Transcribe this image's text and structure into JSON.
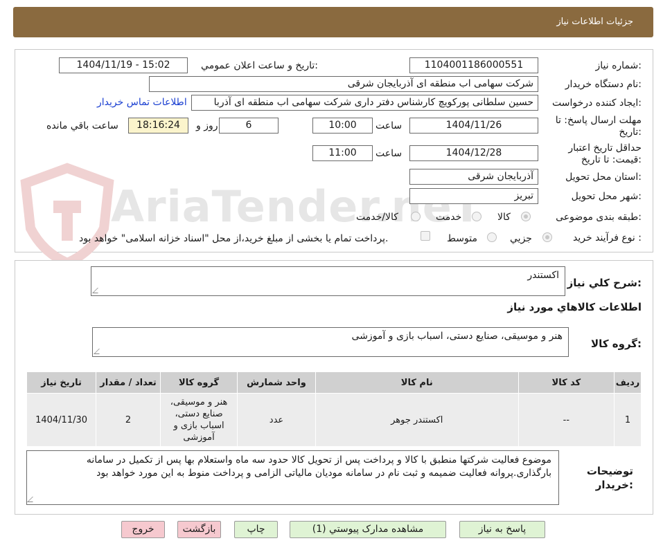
{
  "header": {
    "title": "جزئیات اطلاعات نیاز"
  },
  "watermark": {
    "text": "AriaTender.neT"
  },
  "need": {
    "need_number_label": "شماره نیاز:",
    "need_number": "1104001186000551",
    "announce_label": "تاریخ و ساعت اعلان عمومي:",
    "announce_value": "1404/11/19 - 15:02",
    "buyer_org_label": "نام دستگاه خريدار:",
    "buyer_org": "شرکت سهامی اب منطقه ای آذربایجان شرقی",
    "creator_label": "ايجاد کننده درخواست:",
    "creator": "حسین سلطانی پورکویچ کارشناس دفتر داری شرکت سهامی اب منطقه ای آذربا",
    "contact_link": "اطلاعات تماس خريدار",
    "deadline_label_1": "مهلت ارسال پاسخ: تا",
    "deadline_label_2": "تاريخ:",
    "deadline_date": "1404/11/26",
    "time_label": "ساعت",
    "deadline_time": "10:00",
    "days_value": "6",
    "days_label": "روز و",
    "remaining_time": "18:16:24",
    "remaining_label": "ساعت باقي مانده",
    "validity_label_1": "حداقل تاريخ اعتبار",
    "validity_label_2": "قيمت: تا تاريخ:",
    "validity_date": "1404/12/28",
    "validity_time_label": "ساعت",
    "validity_time": "11:00",
    "province_label": "استان محل تحويل:",
    "province": "آذربایجان شرقی",
    "city_label": "شهر محل تحويل:",
    "city": "تبریز",
    "category_label": "طبقه بندی موضوعی:",
    "category_options": [
      "کالا",
      "خدمت",
      "کالا/خدمت"
    ],
    "process_label": "نوع فرآيند خريد :",
    "process_options": [
      "جزيي",
      "متوسط"
    ],
    "process_note": "پرداخت تمام يا بخشی از مبلغ خريد،از محل \"اسناد خزانه اسلامی\" خواهد بود."
  },
  "description": {
    "general_label": "شرح کلي نياز:",
    "general_value": "اکستندر",
    "goods_info_title": "اطلاعات کالاهاي مورد نياز",
    "goods_group_label": "گروه کالا:",
    "goods_group_value": "هنر و موسیقی، صنایع دستی، اسباب بازی و آموزشی"
  },
  "table": {
    "headers": [
      "رديف",
      "کد کالا",
      "نام کالا",
      "واحد شمارش",
      "گروه کالا",
      "تعداد / مقدار",
      "تاريخ نياز"
    ],
    "rows": [
      {
        "row": "1",
        "code": "--",
        "name": "اکستندر جوهر",
        "unit": "عدد",
        "group": "هنر و موسیقی، صنایع دستی، اسباب بازی و آموزشی",
        "qty": "2",
        "date": "1404/11/30"
      }
    ]
  },
  "buyer_notes": {
    "label_1": "توضيحات",
    "label_2": "خريدار:",
    "text": "موضوع فعالیت شرکتها منطبق با کالا و پرداخت پس از تحویل کالا حدود سه  ماه واستعلام بها پس از تکمیل در سامانه بارگذاری.پروانه فعالیت ضمیمه و ثبت نام در سامانه مودیان مالیاتی الزامی و پرداخت منوط به این مورد خواهد بود"
  },
  "buttons": {
    "reply": "پاسخ به نياز",
    "attachments": "مشاهده مدارک پيوستي (1)",
    "print": "چاپ",
    "back": "بازگشت",
    "exit": "خروج"
  },
  "colors": {
    "header_bg": "#8a6a3f",
    "link": "#1a3fd1",
    "green_button": "#dff3d4",
    "pink_button": "#f6c9cf",
    "remaining_bg": "#fbf4cc"
  }
}
